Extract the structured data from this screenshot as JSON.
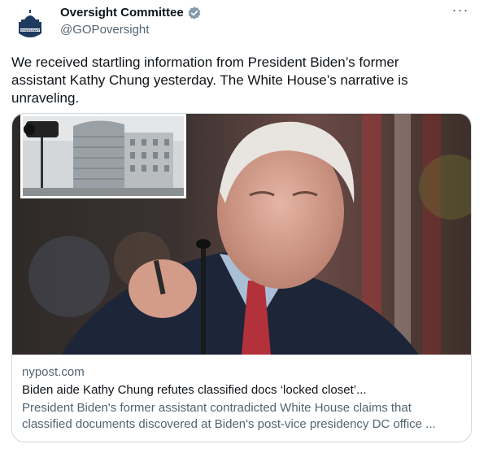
{
  "account": {
    "name": "Oversight Committee",
    "handle": "@GOPoversight",
    "verified_icon": "verified-badge-icon",
    "avatar_icon": "capitol-seal-icon",
    "avatar_text": "OVERSIGHT",
    "colors": {
      "avatar_bg": "#1f3a5f",
      "badge": "#829aab"
    }
  },
  "tweet": {
    "text": "We received startling information from President Biden’s former assistant Kathy Chung yesterday. The White House’s narrative is unraveling."
  },
  "menu": {
    "more_icon": "more-horizontal-icon",
    "more_label": "···"
  },
  "card": {
    "domain": "nypost.com",
    "title": "Biden aide Kathy Chung refutes classified docs ‘locked closet’...",
    "description_line1": "President Biden's former assistant contradicted White House claims that",
    "description_line2": "classified documents discovered at Biden's post-vice presidency DC office ..."
  }
}
